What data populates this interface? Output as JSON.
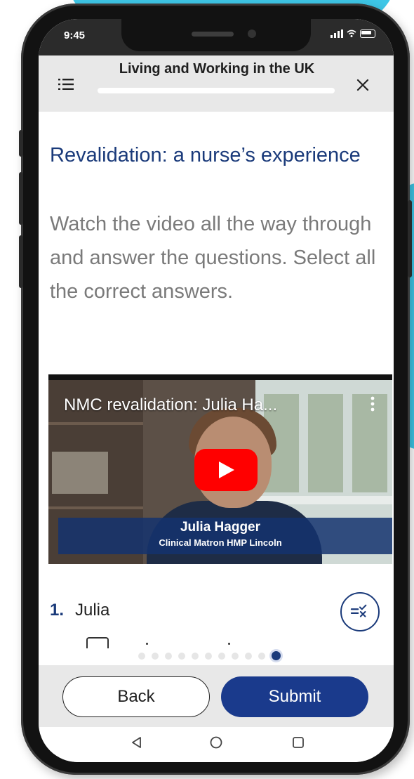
{
  "status_bar": {
    "time": "9:45"
  },
  "header": {
    "title": "Living and Working in the UK",
    "progress": 0.0
  },
  "lesson": {
    "title": "Revalidation: a nurse’s experience",
    "instructions": "Watch the video all the way through and answer the questions. Select all the correct answers."
  },
  "video": {
    "caption": "NMC revalidation: Julia Ha...",
    "lower_third_name": "Julia Hagger",
    "lower_third_role": "Clinical Matron HMP Lincoln"
  },
  "question": {
    "number": "1.",
    "text": "Julia"
  },
  "pager": {
    "total": 11,
    "current": 11
  },
  "actions": {
    "back_label": "Back",
    "submit_label": "Submit"
  },
  "colors": {
    "primary": "#1a3a8c",
    "title_blue": "#1a3a7a",
    "accent_cyan": "#3ec6e6",
    "youtube_red": "#ff0000"
  },
  "icons": {
    "menu": "menu-icon",
    "close": "close-icon",
    "check_answers": "check-answers-icon",
    "more": "more-vertical-icon",
    "play": "play-icon",
    "nav_back": "nav-back-icon",
    "nav_home": "nav-home-icon",
    "nav_recent": "nav-recent-icon"
  }
}
